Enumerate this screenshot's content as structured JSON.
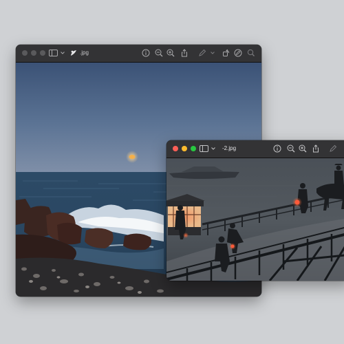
{
  "windows": [
    {
      "title": ".jpg",
      "toolbar_icons": [
        "sidebar-icon",
        "chevron-down-icon",
        "info-icon",
        "zoom-out-icon",
        "zoom-in-icon",
        "share-icon",
        "markup-icon",
        "chevron-down-icon",
        "rotate-icon",
        "annotate-icon",
        "search-icon"
      ],
      "image": "seascape-moonrise"
    },
    {
      "title": "-2.jpg",
      "toolbar_icons": [
        "sidebar-icon",
        "chevron-down-icon",
        "info-icon",
        "zoom-out-icon",
        "zoom-in-icon",
        "share-icon",
        "markup-icon"
      ],
      "image": "woodblock-print-bridge"
    }
  ],
  "colors": {
    "desktop": "#cfd1d4",
    "titlebar": "#333335",
    "close": "#fe5f57",
    "minimize": "#febc2e",
    "zoom": "#28c840",
    "lantern": "#ff5a3a"
  }
}
